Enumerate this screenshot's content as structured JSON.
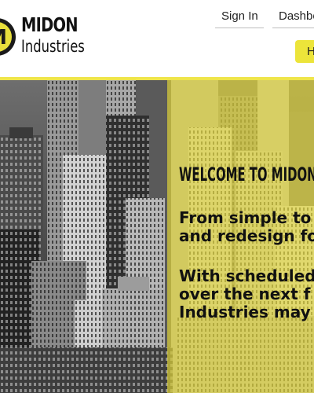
{
  "brand": {
    "name_line1": "MIDON",
    "name_line2": "Industries",
    "badge_letter": "M"
  },
  "nav": {
    "sign_in": "Sign In",
    "dashboard": "Dashbo"
  },
  "cta": {
    "label": "H"
  },
  "hero": {
    "welcome": "WELCOME TO MIDON",
    "para1_line1": "From simple to",
    "para1_line2": "and redesign fo",
    "para2_line1": "With scheduled",
    "para2_line2": "over the next f",
    "para2_line3": "Industries may"
  },
  "colors": {
    "accent": "#ece43a",
    "overlay": "#d8cf3c",
    "text": "#111111"
  }
}
